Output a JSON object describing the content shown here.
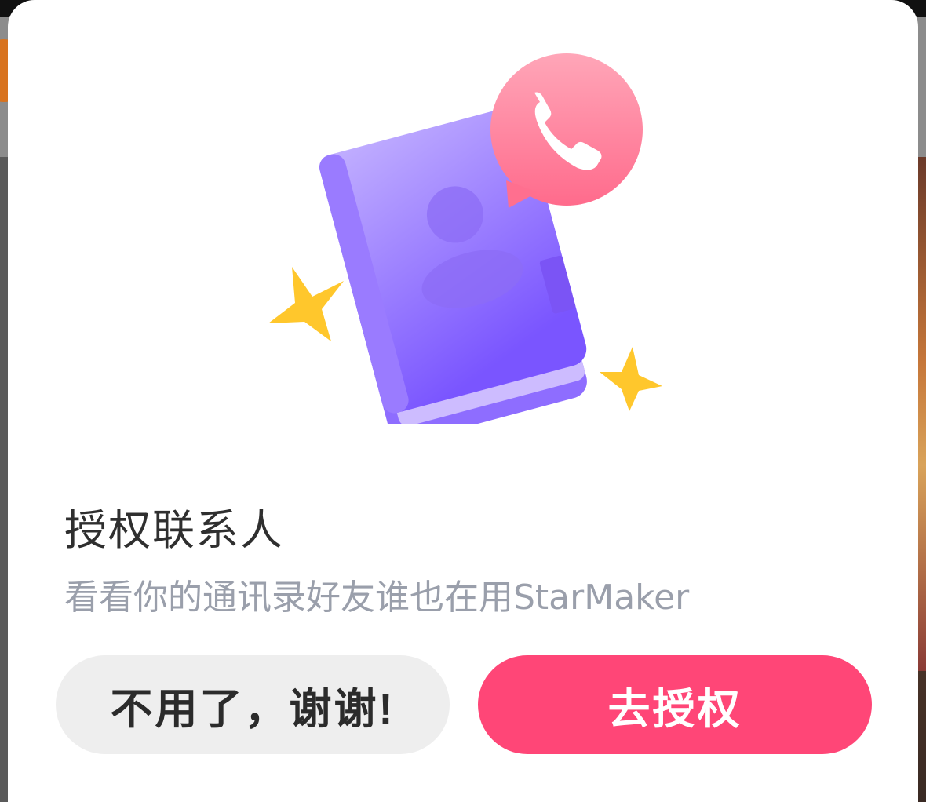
{
  "dialog": {
    "title": "授权联系人",
    "subtitle": "看看你的通讯录好友谁也在用StarMaker",
    "decline_label": "不用了，谢谢!",
    "accept_label": "去授权"
  },
  "illustration": {
    "icon": "contacts-book-icon",
    "badge_icon": "phone-call-bubble-icon",
    "decor_icon": "sparkle-star-icon"
  },
  "colors": {
    "accent": "#ff4677",
    "book": "#8b6cff",
    "bubble": "#ff7f97",
    "star": "#ffc72c",
    "subtitle": "#9a9fab"
  }
}
